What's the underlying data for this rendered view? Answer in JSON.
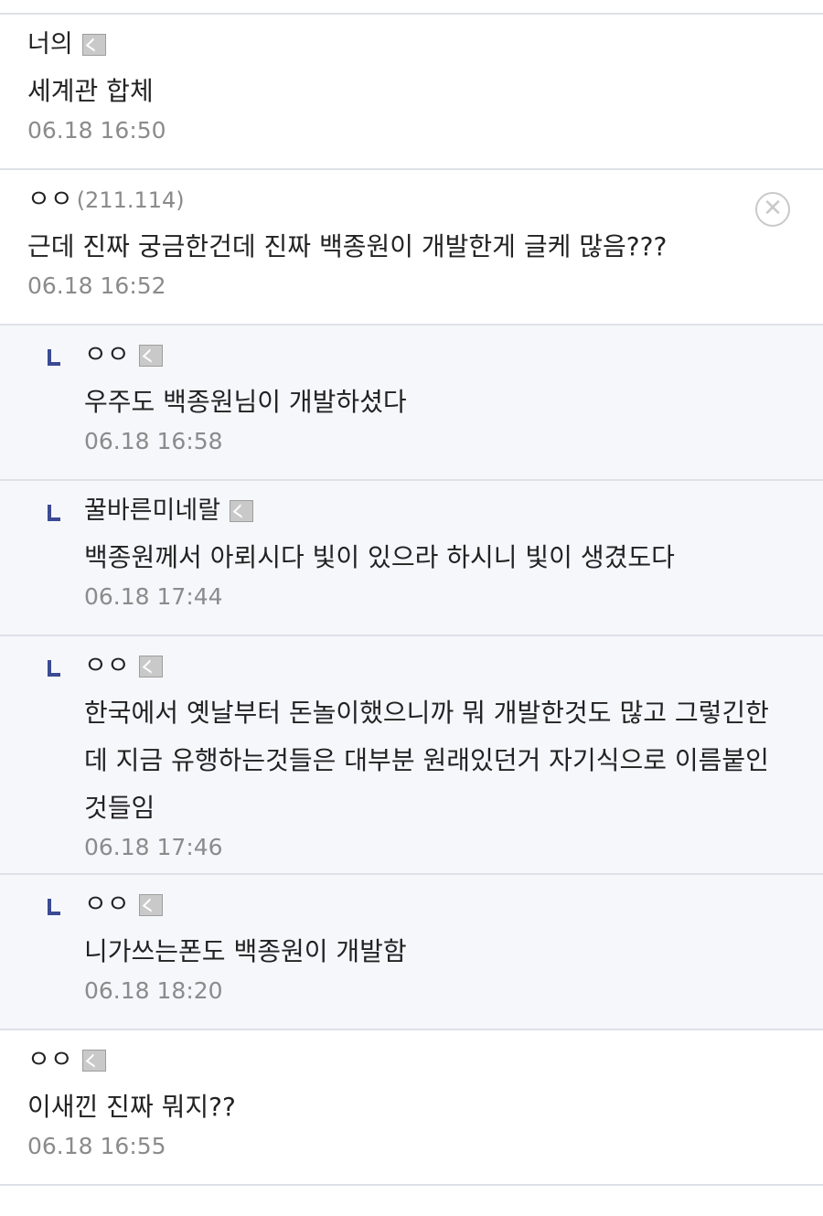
{
  "comments": [
    {
      "nick": "너의",
      "ip": "",
      "text": "세계관 합체",
      "date": "06.18 16:50"
    },
    {
      "nick": "ㅇㅇ",
      "ip": "(211.114)",
      "text": "근데 진짜 궁금한건데 진짜 백종원이 개발한게 글케 많음???",
      "date": "06.18 16:52",
      "delete_icon": "close-circle-icon"
    },
    {
      "nick": "ㅇㅇ",
      "ip": "",
      "text": "우주도 백종원님이 개발하셨다",
      "date": "06.18 16:58",
      "reply": true
    },
    {
      "nick": "꿀바른미네랄",
      "ip": "",
      "text": "백종원께서 아뢰시다 빛이 있으라 하시니 빛이 생겼도다",
      "date": "06.18 17:44",
      "reply": true
    },
    {
      "nick": "ㅇㅇ",
      "ip": "",
      "text_lines": [
        "한국에서 옛날부터 돈놀이했으니까 뭐 개발한것도 많고 그렇긴한",
        "데 지금 유행하는것들은 대부분 원래있던거 자기식으로 이름붙인",
        "것들임"
      ],
      "date": "06.18 17:46",
      "reply": true
    },
    {
      "nick": "ㅇㅇ",
      "ip": "",
      "text": "니가쓰는폰도 백종원이 개발함",
      "date": "06.18 18:20",
      "reply": true
    },
    {
      "nick": "ㅇㅇ",
      "ip": "",
      "text": "이새낀 진짜 뭐지??",
      "date": "06.18 16:55"
    }
  ],
  "icons": {
    "reply": "reply-arrow-icon",
    "gonick": "fixed-nick-icon",
    "delete": "close-circle-icon"
  },
  "colors": {
    "reply_bg": "#f6f7fb",
    "reply_arrow": "#3b4a92",
    "divider": "#dfe1e8",
    "date": "#8b8b8b"
  }
}
